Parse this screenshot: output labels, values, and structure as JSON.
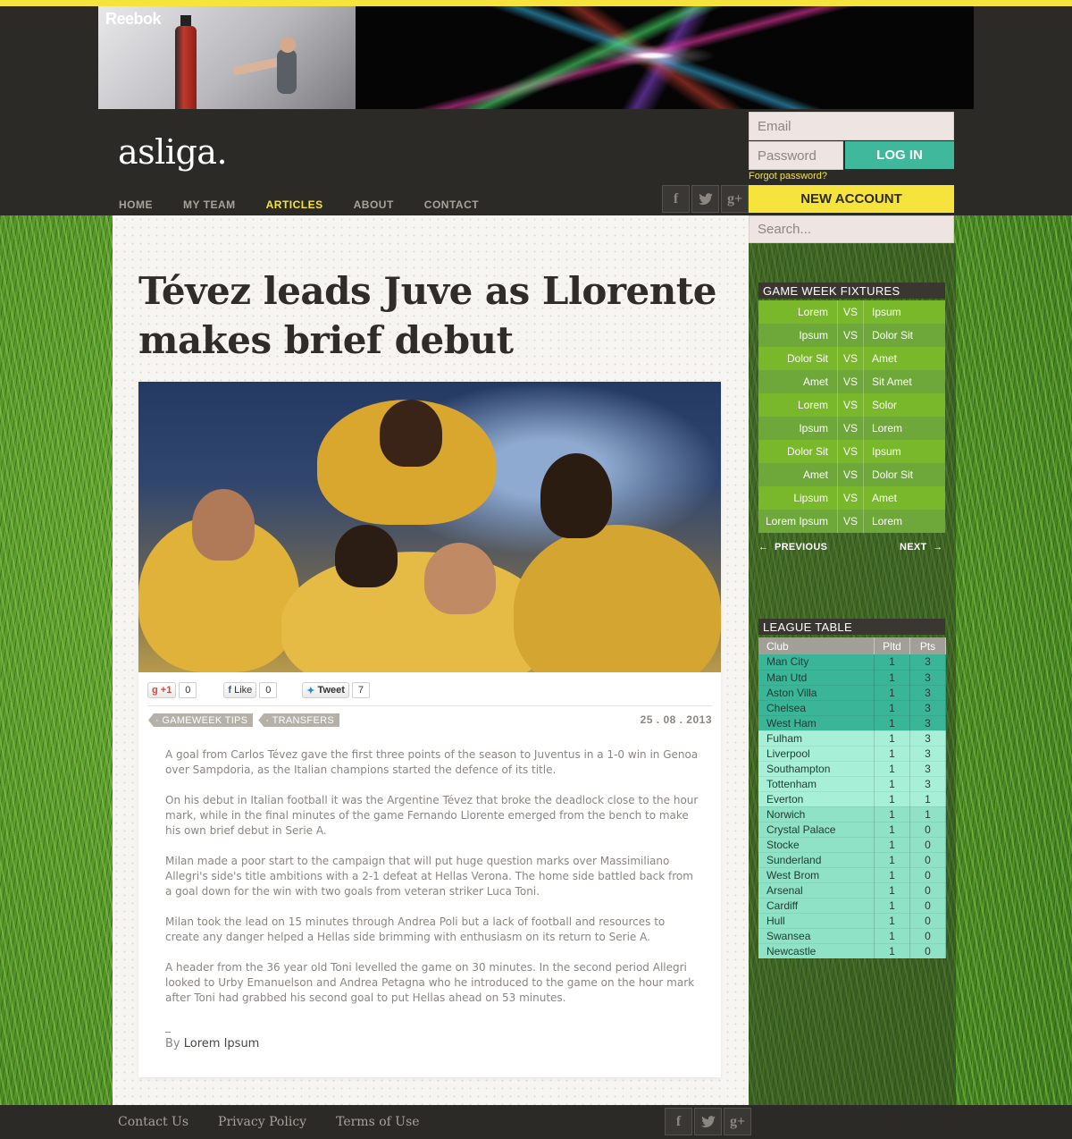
{
  "banner": {
    "brand": "Reebok"
  },
  "site": {
    "logo": "asliga."
  },
  "nav": {
    "items": [
      {
        "label": "HOME"
      },
      {
        "label": "MY TEAM"
      },
      {
        "label": "ARTICLES"
      },
      {
        "label": "ABOUT"
      },
      {
        "label": "CONTACT"
      }
    ],
    "active": "ARTICLES"
  },
  "social": {
    "facebook": "f",
    "twitter": "t",
    "googleplus": "g+"
  },
  "login": {
    "email_placeholder": "Email",
    "password_placeholder": "Password",
    "login_label": "LOG IN",
    "forgot_label": "Forgot password?",
    "new_account_label": "NEW ACCOUNT"
  },
  "search": {
    "placeholder": "Search..."
  },
  "article": {
    "title": "Tévez leads Juve as Llorente makes brief debut",
    "share": {
      "gplus_label": "+1",
      "gplus_count": "0",
      "fb_label": "Like",
      "fb_count": "0",
      "tweet_label": "Tweet",
      "tweet_count": "7"
    },
    "tags": [
      "GAMEWEEK TIPS",
      "TRANSFERS"
    ],
    "date": "25 . 08 . 2013",
    "paragraphs": [
      "A goal from Carlos Tévez gave the first three points of the season to Juventus in a 1-0 win in Genoa over Sampdoria, as the Italian champions started the defence of its title.",
      "On his debut in Italian football it was the Argentine Tévez that broke the deadlock close to the hour mark, while in the final minutes of the game Fernando Llorente emerged from the bench to make his own brief debut in Serie A.",
      "Milan made a poor start to the campaign that will put huge question marks over Massimiliano Allegri's side's title ambitions with a 2-1 defeat at Hellas Verona. The home side battled back from a goal down for the win with two goals from veteran striker Luca Toni.",
      "Milan took the lead on 15 minutes through Andrea Poli but a lack of football and resources to create any danger helped a Hellas side brimming with enthusiasm on its return to Serie A.",
      "A header from the 36 year old Toni levelled the game on 30 minutes. In the second period Allegri looked to Urby Emanuelson and Andrea Petagna who he introduced to the game on the hour mark after Toni had grabbed his second goal to put Hellas ahead on 53 minutes."
    ],
    "byline_prefix": "By",
    "author": "Lorem Ipsum",
    "separator": "_"
  },
  "fixtures": {
    "title": "GAME WEEK FIXTURES",
    "vs_label": "VS",
    "rows": [
      {
        "home": "Lorem",
        "away": "Ipsum"
      },
      {
        "home": "Ipsum",
        "away": "Dolor Sit"
      },
      {
        "home": "Dolor Sit",
        "away": "Amet"
      },
      {
        "home": "Amet",
        "away": "Sit Amet"
      },
      {
        "home": "Lorem",
        "away": "Solor"
      },
      {
        "home": "Ipsum",
        "away": "Lorem"
      },
      {
        "home": "Dolor Sit",
        "away": "Ipsum"
      },
      {
        "home": "Amet",
        "away": "Dolor Sit"
      },
      {
        "home": "Lipsum",
        "away": "Amet"
      },
      {
        "home": "Lorem Ipsum",
        "away": "Lorem"
      }
    ],
    "previous_label": "PREVIOUS",
    "next_label": "NEXT"
  },
  "league": {
    "title": "LEAGUE TABLE",
    "headers": [
      "Club",
      "Pltd",
      "Pts"
    ],
    "rows": [
      {
        "club": "Man City",
        "pltd": "1",
        "pts": "3"
      },
      {
        "club": "Man Utd",
        "pltd": "1",
        "pts": "3"
      },
      {
        "club": "Aston Villa",
        "pltd": "1",
        "pts": "3"
      },
      {
        "club": "Chelsea",
        "pltd": "1",
        "pts": "3"
      },
      {
        "club": "West Ham",
        "pltd": "1",
        "pts": "3"
      },
      {
        "club": "Fulham",
        "pltd": "1",
        "pts": "3"
      },
      {
        "club": "Liverpool",
        "pltd": "1",
        "pts": "3"
      },
      {
        "club": "Southampton",
        "pltd": "1",
        "pts": "3"
      },
      {
        "club": "Tottenham",
        "pltd": "1",
        "pts": "3"
      },
      {
        "club": "Everton",
        "pltd": "1",
        "pts": "1"
      },
      {
        "club": "Norwich",
        "pltd": "1",
        "pts": "1"
      },
      {
        "club": "Crystal Palace",
        "pltd": "1",
        "pts": "0"
      },
      {
        "club": "Stocke",
        "pltd": "1",
        "pts": "0"
      },
      {
        "club": "Sunderland",
        "pltd": "1",
        "pts": "0"
      },
      {
        "club": "West Brom",
        "pltd": "1",
        "pts": "0"
      },
      {
        "club": "Arsenal",
        "pltd": "1",
        "pts": "0"
      },
      {
        "club": "Cardiff",
        "pltd": "1",
        "pts": "0"
      },
      {
        "club": "Hull",
        "pltd": "1",
        "pts": "0"
      },
      {
        "club": "Swansea",
        "pltd": "1",
        "pts": "0"
      },
      {
        "club": "Newcastle",
        "pltd": "1",
        "pts": "0"
      }
    ]
  },
  "footer": {
    "links": [
      "Contact Us",
      "Privacy Policy",
      "Terms of Use"
    ]
  },
  "colors": {
    "accent_yellow": "#f6e33b",
    "accent_teal": "#3fb89b",
    "dark": "#2c2a27"
  }
}
